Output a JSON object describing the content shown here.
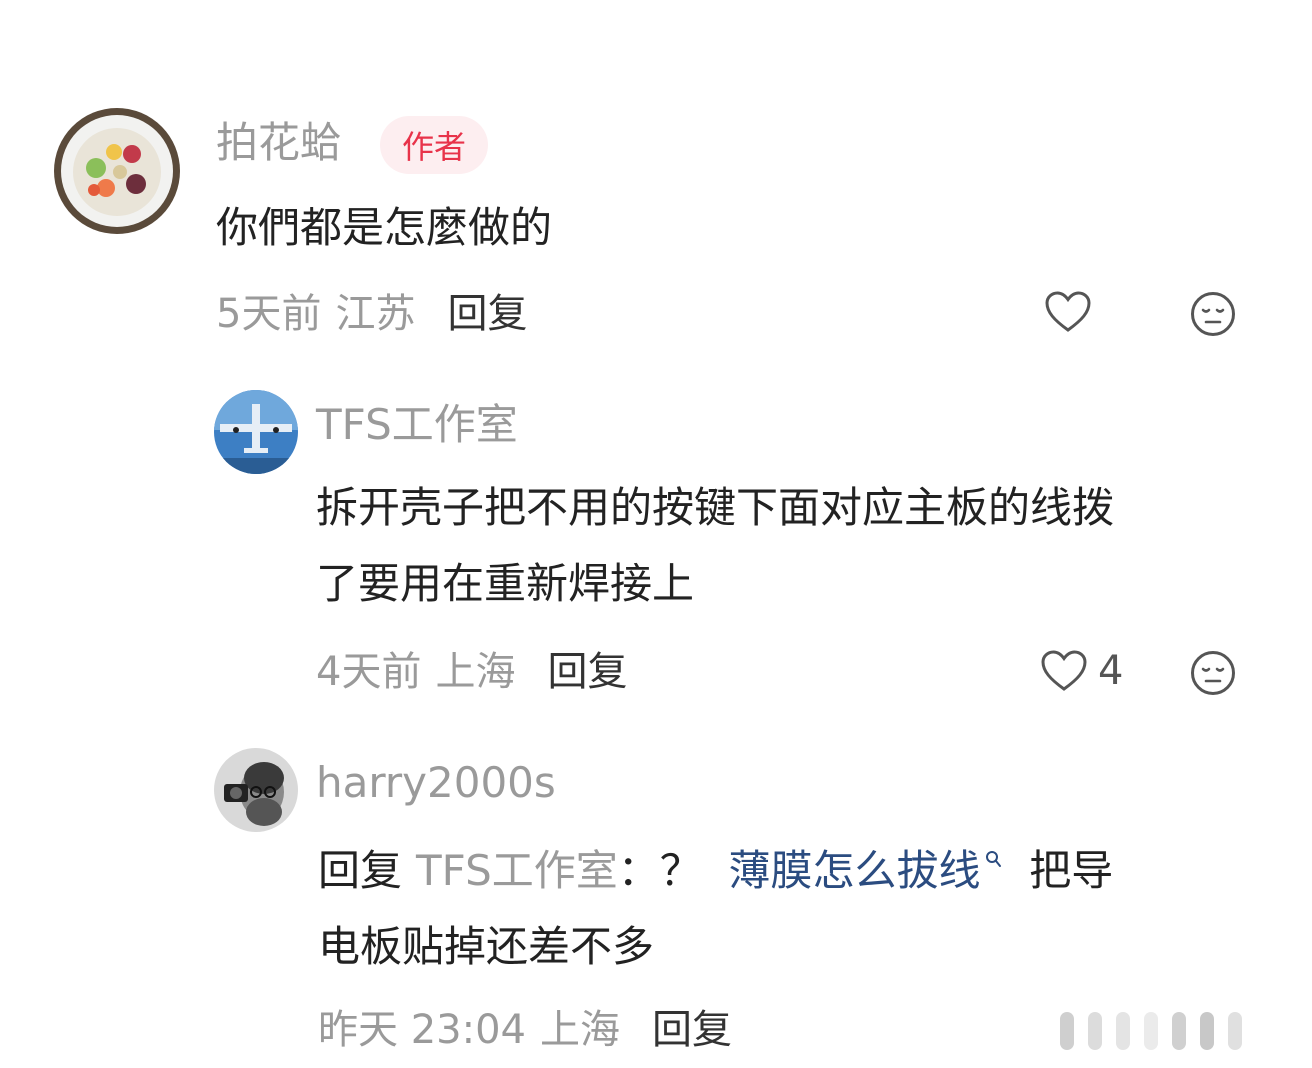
{
  "comments": [
    {
      "user": "拍花蛤",
      "badge": "作者",
      "text": "你們都是怎麼做的",
      "time": "5天前",
      "location": "江苏",
      "reply_label": "回复",
      "likes": ""
    },
    {
      "user": "TFS工作室",
      "text_line1": "拆开壳子把不用的按键下面对应主板的线拨",
      "text_line2": "了要用在重新焊接上",
      "time": "4天前",
      "location": "上海",
      "reply_label": "回复",
      "likes": "4"
    },
    {
      "user": "harry2000s",
      "reply_prefix": "回复",
      "reply_to": "TFS工作室",
      "colon": "：？",
      "keyword": "薄膜怎么拔线",
      "text_after_keyword": "把导",
      "text_line2": "电板贴掉还差不多",
      "time": "昨天 23:04",
      "location": "上海",
      "reply_label": "回复"
    }
  ],
  "colors": {
    "author_badge_bg": "#fdeef0",
    "author_badge_text": "#e8334a",
    "keyword_link": "#2b4c80",
    "meta_gray": "#9a9a9a"
  },
  "icons": [
    "heart-outline-icon",
    "dislike-face-icon",
    "search-icon"
  ]
}
